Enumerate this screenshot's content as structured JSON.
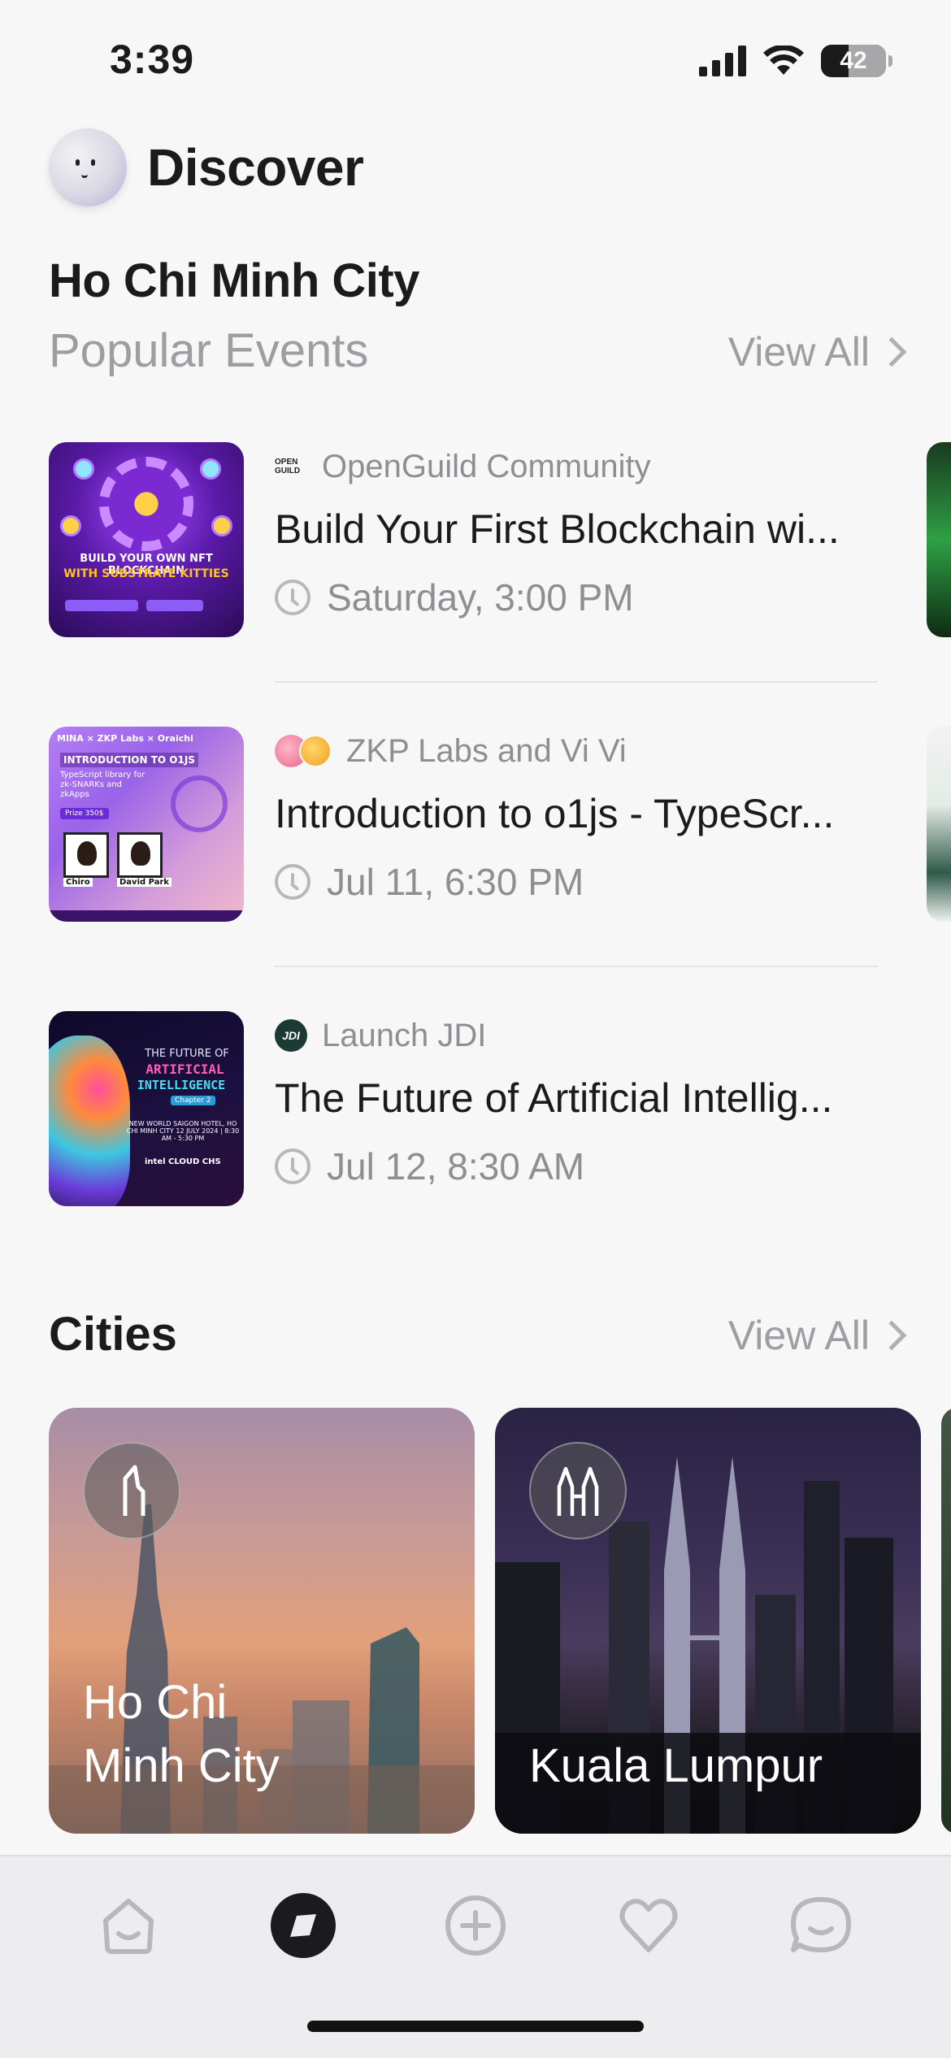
{
  "status_bar": {
    "time": "3:39",
    "battery": "42"
  },
  "header": {
    "title": "Discover",
    "avatar_icon": "emoji-face-avatar"
  },
  "popular": {
    "city": "Ho Chi Minh City",
    "subtitle": "Popular Events",
    "view_all": "View All",
    "events": [
      {
        "host": "OpenGuild Community",
        "host_logo": "openguild-logo",
        "title": "Build Your First Blockchain wi...",
        "time": "Saturday, 3:00 PM",
        "thumb": {
          "line1": "BUILD YOUR OWN NFT BLOCKCHAIN",
          "line2": "WITH SUBSTRATE KITTIES"
        }
      },
      {
        "host": "ZKP Labs and Vi Vi",
        "host_logo": "zkp-labs-and-vi-vi-avatars",
        "title": "Introduction to o1js - TypeScr...",
        "time": "Jul 11, 6:30 PM",
        "thumb": {
          "header": "MINA × ZKP Labs × Oraichi",
          "title": "INTRODUCTION TO O1JS",
          "subtitle": "TypeScript library for zk-SNARKs and zkApps",
          "prize": "Prize 350$",
          "speaker1": "Chiro",
          "speaker2": "David Park"
        }
      },
      {
        "host": "Launch JDI",
        "host_logo": "launch-jdi-logo",
        "title": "The Future of Artificial Intellig...",
        "time": "Jul 12, 8:30 AM",
        "thumb": {
          "line1": "THE FUTURE OF",
          "line2": "ARTIFICIAL",
          "line3": "INTELLIGENCE",
          "tag": "Chapter 2",
          "info": "NEW WORLD SAIGON HOTEL, HO CHI MINH CITY 12 JULY 2024 | 8:30 AM - 5:30 PM",
          "sponsors": "intel  CLOUD  CHS"
        }
      }
    ]
  },
  "cities": {
    "heading": "Cities",
    "view_all": "View All",
    "items": [
      {
        "name": "Ho Chi Minh City",
        "name_line1": "Ho Chi",
        "name_line2": "Minh City",
        "icon": "bitexco-tower-icon"
      },
      {
        "name": "Kuala Lumpur",
        "icon": "petronas-towers-icon"
      }
    ]
  },
  "tab_bar": {
    "items": [
      {
        "icon": "home-icon",
        "active": false
      },
      {
        "icon": "discover-compass-icon",
        "active": true
      },
      {
        "icon": "add-event-icon",
        "active": false
      },
      {
        "icon": "heart-icon",
        "active": false
      },
      {
        "icon": "chat-icon",
        "active": false
      }
    ]
  },
  "colors": {
    "text": "#1b1b1d",
    "muted": "#9d9da2",
    "background": "#f7f7f8",
    "tab_active": "#1b1b1d",
    "tab_inactive": "#b8b8bc"
  }
}
